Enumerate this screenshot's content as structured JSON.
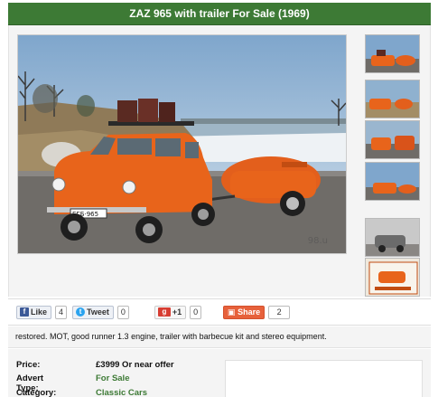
{
  "listing": {
    "title": "ZAZ 965 with trailer For Sale (1969)",
    "photo_watermark": "98.u",
    "description": "restored. MOT, good runner 1.3 engine, trailer with barbecue kit and stereo equipment."
  },
  "gallery": {
    "thumbnails": [
      "photo-1",
      "photo-2",
      "photo-3",
      "photo-4",
      "photo-5",
      "photo-6"
    ]
  },
  "social": {
    "like_label": "Like",
    "like_count": "4",
    "tweet_label": "Tweet",
    "tweet_count": "0",
    "gplus_label": "+1",
    "gplus_count": "0",
    "share_label": "Share",
    "share_count": "2",
    "like_icon": "facebook-icon",
    "tweet_icon": "twitter-icon",
    "gplus_icon": "google-plus-icon",
    "share_icon": "share-icon"
  },
  "details": {
    "price_label": "Price:",
    "price_value": "£3999 Or near offer",
    "advert_type_label": "Advert Type:",
    "advert_type_value": "For Sale",
    "category_label": "Category:",
    "category_value": "Classic Cars"
  },
  "colors": {
    "header_bg": "#3d7a35",
    "accent_green": "#3d7a35",
    "car_orange": "#e8641b"
  }
}
